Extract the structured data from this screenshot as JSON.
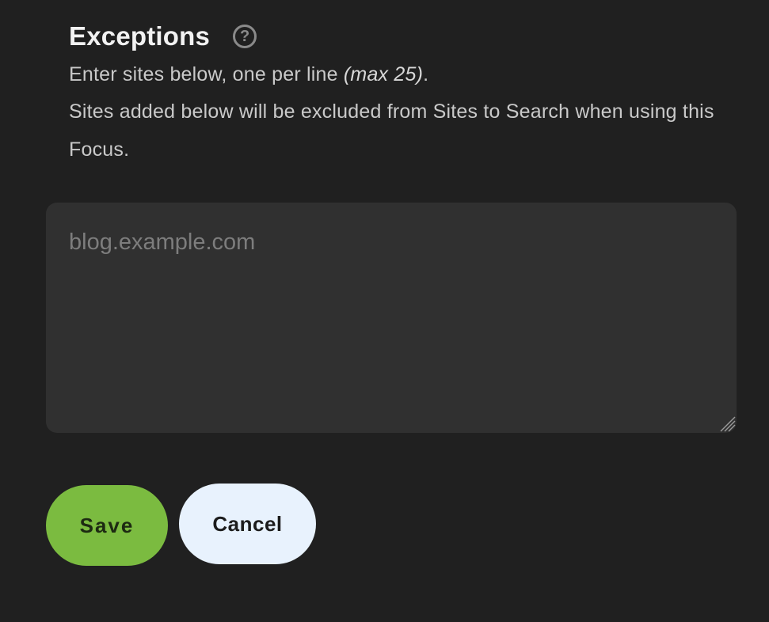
{
  "exceptions": {
    "title": "Exceptions",
    "help_icon": "question-circle-icon",
    "desc_line1_prefix": "Enter sites below, one per line ",
    "desc_line1_max": "(max 25)",
    "desc_line1_suffix": ".",
    "desc_line2": "Sites added below will be excluded from Sites to Search when using this Focus.",
    "textarea": {
      "value": "",
      "placeholder": "blog.example.com",
      "resize_icon": "resize-grip-icon"
    }
  },
  "actions": {
    "save_label": "Save",
    "cancel_label": "Cancel"
  },
  "colors": {
    "background": "#202020",
    "field_bg": "#303030",
    "save_bg": "#7bbb40",
    "cancel_bg": "#e8f2fd",
    "text_primary": "#f2f2f2",
    "text_secondary": "#c9c9c9",
    "placeholder": "#7d7d7d"
  }
}
